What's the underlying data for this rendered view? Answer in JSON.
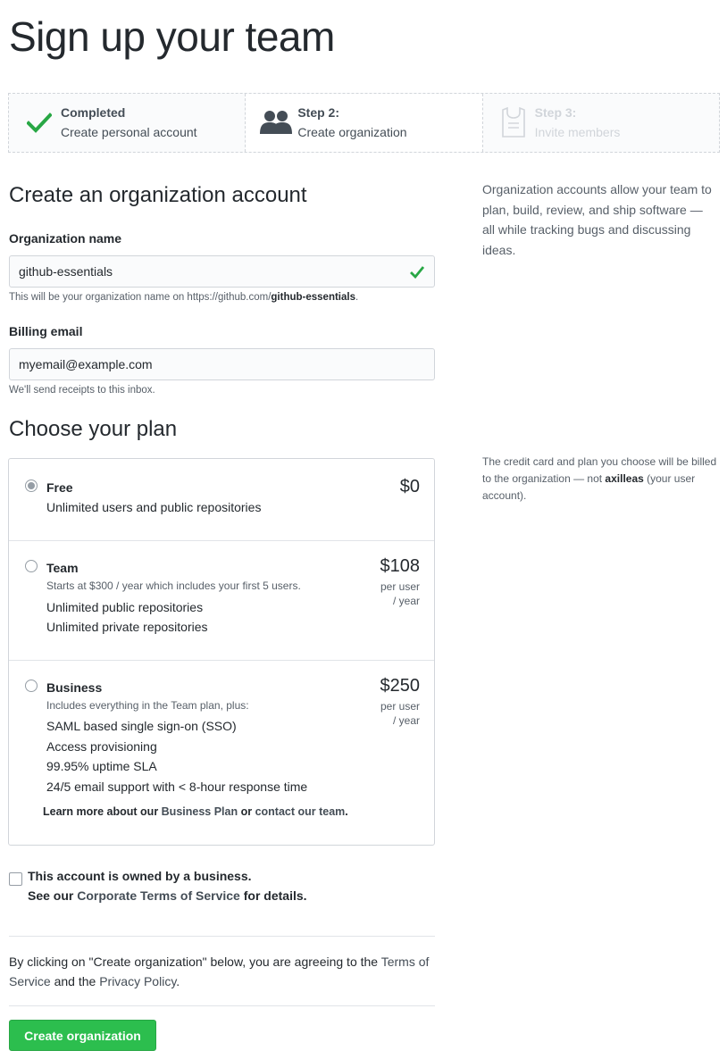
{
  "page": {
    "title": "Sign up your team"
  },
  "steps": [
    {
      "title": "Completed",
      "desc": "Create personal account",
      "icon": "check-icon",
      "state": "completed"
    },
    {
      "title": "Step 2:",
      "desc": "Create organization",
      "icon": "people-icon",
      "state": "current"
    },
    {
      "title": "Step 3:",
      "desc": "Invite members",
      "icon": "jersey-icon",
      "state": "pending"
    }
  ],
  "org": {
    "section_title": "Create an organization account",
    "name_label": "Organization name",
    "name_value": "github-essentials",
    "name_note_prefix": "This will be your organization name on https://github.com/",
    "name_note_handle": "github-essentials",
    "name_note_suffix": ".",
    "email_label": "Billing email",
    "email_value": "myemail@example.com",
    "email_note": "We'll send receipts to this inbox.",
    "side_text": "Organization accounts allow your team to plan, build, review, and ship software — all while tracking bugs and discussing ideas."
  },
  "plan": {
    "section_title": "Choose your plan",
    "side_prefix": "The credit card and plan you choose will be billed to the organization — not ",
    "side_user": "axilleas",
    "side_suffix": " (your user account).",
    "selected": "Free",
    "plans": [
      {
        "name": "Free",
        "price": "$0",
        "features": [
          "Unlimited users and public repositories"
        ]
      },
      {
        "name": "Team",
        "price": "$108",
        "per_1": "per user",
        "per_2": "/ year",
        "sub": "Starts at $300 / year which includes your first 5 users.",
        "features": [
          "Unlimited public repositories",
          "Unlimited private repositories"
        ]
      },
      {
        "name": "Business",
        "price": "$250",
        "per_1": "per user",
        "per_2": "/ year",
        "sub": "Includes everything in the Team plan, plus:",
        "features": [
          "SAML based single sign-on (SSO)",
          "Access provisioning",
          "99.95% uptime SLA",
          "24/5 email support with < 8-hour response time"
        ],
        "learn_prefix": "Learn more about our ",
        "learn_link1": "Business Plan",
        "learn_mid": " or ",
        "learn_link2": "contact our team",
        "learn_suffix": "."
      }
    ]
  },
  "business": {
    "line1": "This account is owned by a business.",
    "line2_prefix": "See our ",
    "line2_link": "Corporate Terms of Service",
    "line2_suffix": " for details.",
    "checked": false
  },
  "agreement": {
    "prefix": "By clicking on \"Create organization\" below, you are agreeing to the ",
    "tos_link": "Terms of Service",
    "mid": " and the ",
    "privacy_link": "Privacy Policy",
    "suffix": "."
  },
  "submit": {
    "label": "Create organization"
  },
  "colors": {
    "primary_button": "#2cbe4e",
    "check_green": "#28a745",
    "border": "#d1d5da",
    "muted_text": "#586069"
  }
}
